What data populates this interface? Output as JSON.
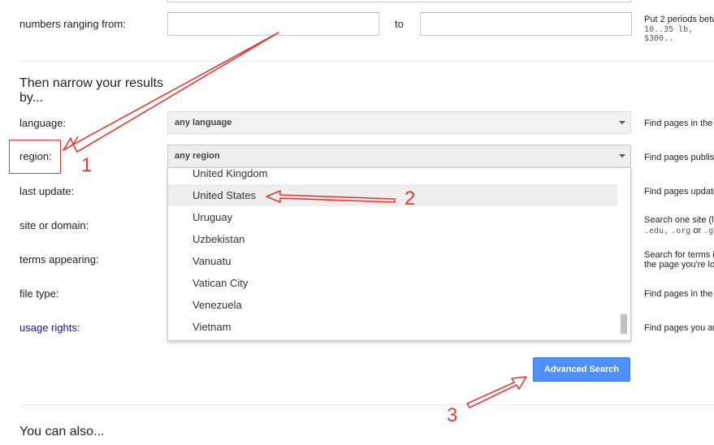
{
  "numbers_row": {
    "label": "numbers ranging from:",
    "to_label": "to",
    "help_line1": "Put 2 periods betw",
    "help_line2": "10..35 lb, $300.."
  },
  "narrow": {
    "heading_line1": "Then narrow your results",
    "heading_line2": "by..."
  },
  "language": {
    "label": "language:",
    "value": "any language",
    "help": "Find pages in the"
  },
  "region": {
    "label": "region:",
    "value": "any region",
    "help": "Find pages publis",
    "options": [
      "United Kingdom",
      "United States",
      "Uruguay",
      "Uzbekistan",
      "Vanuatu",
      "Vatican City",
      "Venezuela",
      "Vietnam"
    ],
    "highlighted": "United States"
  },
  "last_update": {
    "label": "last update:",
    "help": "Find pages update"
  },
  "site": {
    "label": "site or domain:",
    "help_line1": "Search one site (l",
    "help_line2a": ".edu,",
    "help_line2b": ".org",
    "help_line2c": "or",
    "help_line2d": ".gov"
  },
  "terms": {
    "label": "terms appearing:",
    "help_line1": "Search for terms i",
    "help_line2": "the page you're lo"
  },
  "file_type": {
    "label": "file type:",
    "help": "Find pages in the"
  },
  "usage_rights": {
    "label": "usage rights:",
    "help": "Find pages you ar"
  },
  "advanced_search_button": "Advanced Search",
  "also": {
    "heading": "You can also..."
  },
  "annotations": {
    "n1": "1",
    "n2": "2",
    "n3": "3",
    "color": "#e53935"
  }
}
